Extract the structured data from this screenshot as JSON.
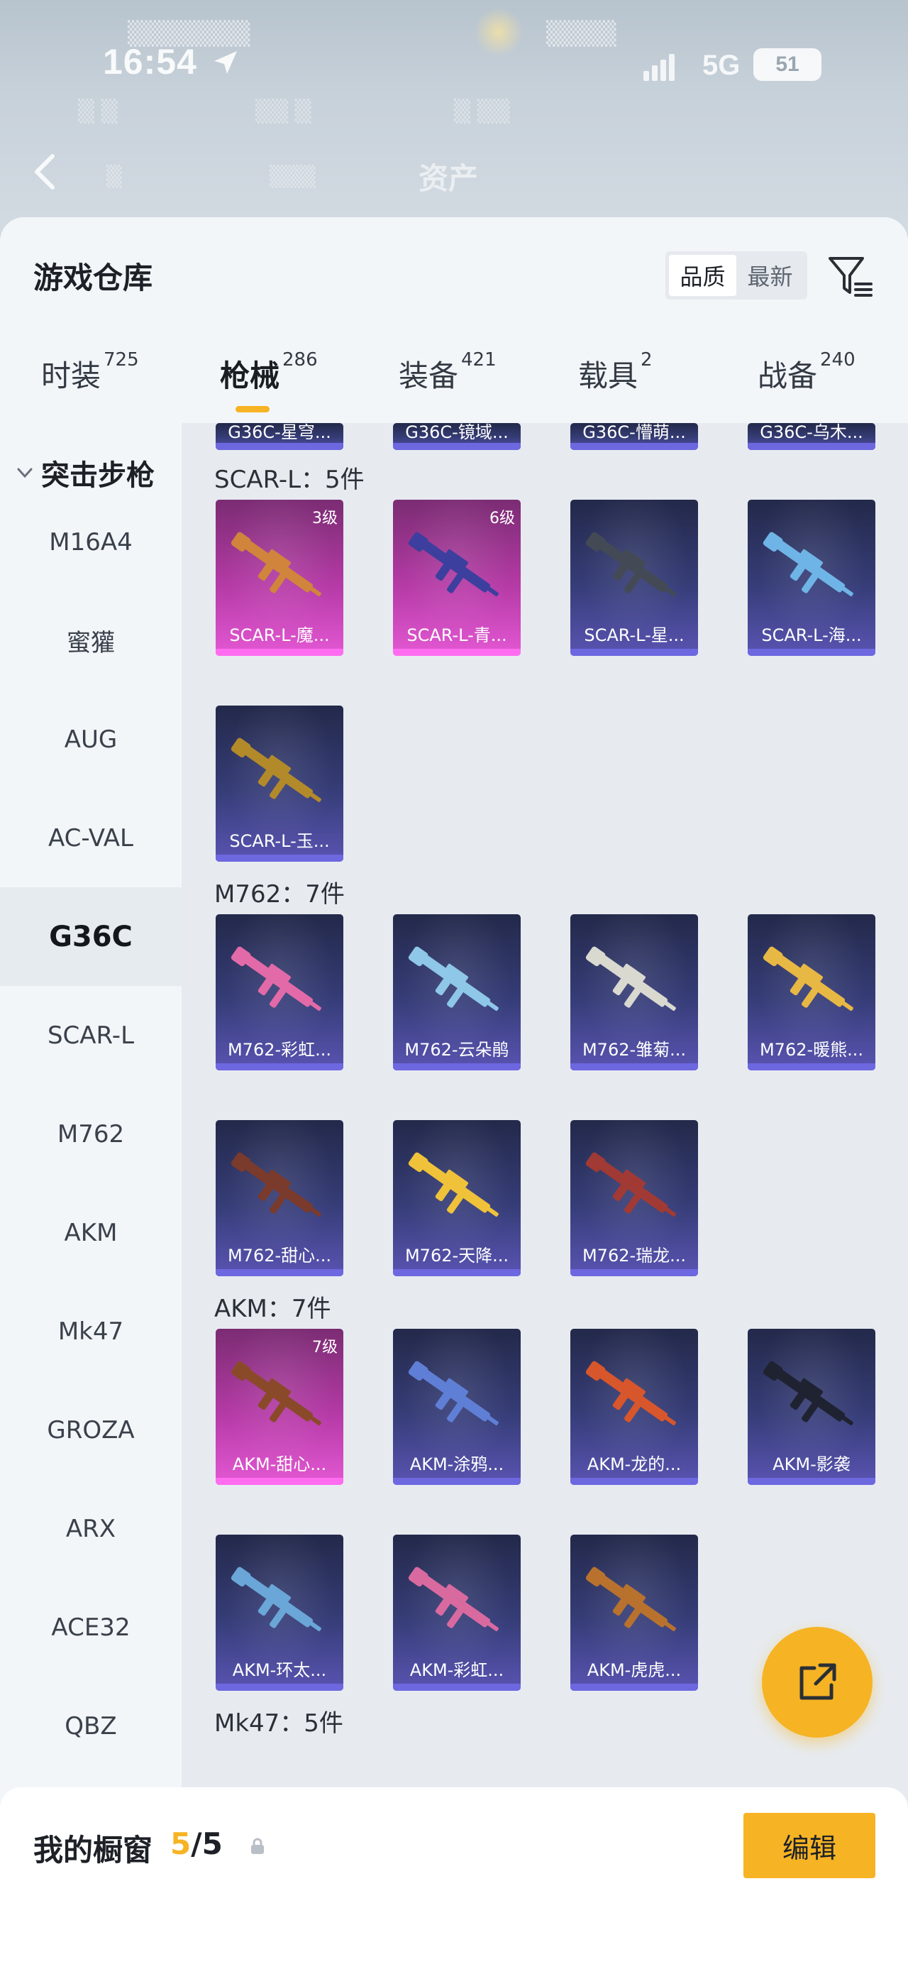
{
  "status_bar": {
    "time": "16:54",
    "network": "5G",
    "battery": "51"
  },
  "header_backdrop": {
    "title": "资产"
  },
  "sheet": {
    "title": "游戏仓库",
    "sort_options": [
      "品质",
      "最新"
    ],
    "active_sort": "品质"
  },
  "tabs": [
    {
      "label": "时装",
      "count": "725"
    },
    {
      "label": "枪械",
      "count": "286"
    },
    {
      "label": "装备",
      "count": "421"
    },
    {
      "label": "载具",
      "count": "2"
    },
    {
      "label": "战备",
      "count": "240"
    }
  ],
  "active_tab": "枪械",
  "sidebar": {
    "group": "突击步枪",
    "items": [
      "M16A4",
      "蜜獾",
      "AUG",
      "AC-VAL",
      "G36C",
      "SCAR-L",
      "M762",
      "AKM",
      "Mk47",
      "GROZA",
      "ARX",
      "ACE32",
      "QBZ"
    ],
    "active": "G36C"
  },
  "top_cut_cards": [
    "G36C-星穹...",
    "G36C-镜域...",
    "G36C-懵萌...",
    "G36C-乌木..."
  ],
  "sections": [
    {
      "label": "SCAR-L：5件",
      "cards": [
        {
          "name": "SCAR-L-魔...",
          "level": "3级",
          "rarity": "pink",
          "gun_color": "#d0843c"
        },
        {
          "name": "SCAR-L-青...",
          "level": "6级",
          "rarity": "pink",
          "gun_color": "#3d3f9e"
        },
        {
          "name": "SCAR-L-星...",
          "level": "",
          "rarity": "blue",
          "gun_color": "#444a55"
        },
        {
          "name": "SCAR-L-海...",
          "level": "",
          "rarity": "blue",
          "gun_color": "#6fb4e6"
        },
        {
          "name": "SCAR-L-玉...",
          "level": "",
          "rarity": "blue",
          "gun_color": "#b38a2a"
        }
      ]
    },
    {
      "label": "M762：7件",
      "cards": [
        {
          "name": "M762-彩虹...",
          "level": "",
          "rarity": "blue",
          "gun_color": "#e26aa8"
        },
        {
          "name": "M762-云朵鹃",
          "level": "",
          "rarity": "blue",
          "gun_color": "#8ec7e8"
        },
        {
          "name": "M762-雏菊...",
          "level": "",
          "rarity": "blue",
          "gun_color": "#d9d9d0"
        },
        {
          "name": "M762-暖熊...",
          "level": "",
          "rarity": "blue",
          "gun_color": "#e8b844"
        },
        {
          "name": "M762-甜心...",
          "level": "",
          "rarity": "blue",
          "gun_color": "#7a3a2c"
        },
        {
          "name": "M762-天降...",
          "level": "",
          "rarity": "blue",
          "gun_color": "#f0c23a"
        },
        {
          "name": "M762-瑞龙...",
          "level": "",
          "rarity": "blue",
          "gun_color": "#a13a34"
        }
      ]
    },
    {
      "label": "AKM：7件",
      "cards": [
        {
          "name": "AKM-甜心...",
          "level": "7级",
          "rarity": "pink",
          "gun_color": "#8a4a2a"
        },
        {
          "name": "AKM-涂鸦...",
          "level": "",
          "rarity": "blue",
          "gun_color": "#5f7fd6"
        },
        {
          "name": "AKM-龙的...",
          "level": "",
          "rarity": "blue",
          "gun_color": "#d8562c"
        },
        {
          "name": "AKM-影袭",
          "level": "",
          "rarity": "blue",
          "gun_color": "#1f2230"
        },
        {
          "name": "AKM-环太...",
          "level": "",
          "rarity": "blue",
          "gun_color": "#6aa6d8"
        },
        {
          "name": "AKM-彩虹...",
          "level": "",
          "rarity": "blue",
          "gun_color": "#d96aa0"
        },
        {
          "name": "AKM-虎虎...",
          "level": "",
          "rarity": "blue",
          "gun_color": "#b8722e"
        }
      ]
    },
    {
      "label": "Mk47：5件",
      "cards": []
    }
  ],
  "showcase": {
    "title": "我的橱窗",
    "count_current": "5",
    "count_total": "/5",
    "edit_label": "编辑"
  },
  "colors": {
    "accent": "#f6b323",
    "card_blue": "#363d78",
    "card_pink": "#b53aa6"
  }
}
